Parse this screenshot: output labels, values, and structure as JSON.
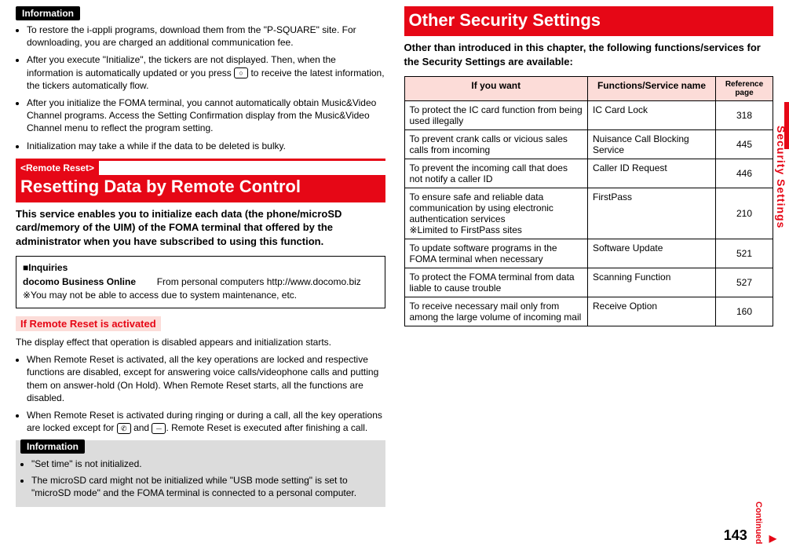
{
  "side_label": "Security Settings",
  "page_number": "143",
  "continued_label": "Continued",
  "left": {
    "info_label": "Information",
    "top_bullets": [
      "To restore the i-αppli programs, download them from the \"P-SQUARE\" site. For downloading, you are charged an additional communication fee.",
      "After you execute \"Initialize\", the tickers are not displayed. Then, when the information is automatically updated or you press ⬜ to receive the latest information, the tickers automatically flow.",
      "After you initialize the FOMA terminal, you cannot automatically obtain Music&Video Channel programs. Access the Setting Confirmation display from the Music&Video Channel menu to reflect the program setting.",
      "Initialization may take a while if the data to be deleted is bulky."
    ],
    "banner_tag": "<Remote Reset>",
    "banner_title": "Resetting Data by Remote Control",
    "lead": "This service enables you to initialize each data (the phone/microSD card/memory of the UIM) of the FOMA terminal that offered by the administrator when you have subscribed to using this function.",
    "box_inq": "■Inquiries",
    "box_line1a": "docomo Business Online",
    "box_line1b": "From personal computers   http://www.docomo.biz",
    "box_line2": "※You may not be able to access due to system maintenance, etc.",
    "sub_pink": "If Remote Reset is activated",
    "para1": "The display effect that operation is disabled appears and initialization starts.",
    "para_bullets": [
      "When Remote Reset is activated, all the key operations are locked and respective functions are disabled, except for answering voice calls/videophone calls and putting them on answer-hold (On Hold). When Remote Reset starts, all the functions are disabled.",
      "When Remote Reset is activated during ringing or during a call, all the key operations are locked except for ⬜ and ⬜. Remote Reset is executed after finishing a call."
    ],
    "info2_label": "Information",
    "info2_bullets": [
      "\"Set time\" is not initialized.",
      "The microSD card might not be initialized while \"USB mode setting\" is set to \"microSD mode\" and the FOMA terminal is connected to a personal computer."
    ]
  },
  "right": {
    "banner_title": "Other Security Settings",
    "lead": "Other than introduced in this chapter, the following functions/services for the Security Settings are available:",
    "headers": {
      "c1": "If you want",
      "c2": "Functions/Service name",
      "c3": "Reference page"
    },
    "rows": [
      {
        "want": "To protect the IC card function from being used illegally",
        "fn": "IC Card Lock",
        "ref": "318"
      },
      {
        "want": "To prevent crank calls or vicious sales calls from incoming",
        "fn": "Nuisance Call Blocking Service",
        "ref": "445"
      },
      {
        "want": "To prevent the incoming call that does not notify a caller ID",
        "fn": "Caller ID Request",
        "ref": "446"
      },
      {
        "want": "To ensure safe and reliable data communication by using electronic authentication services\n※Limited to FirstPass sites",
        "fn": "FirstPass",
        "ref": "210"
      },
      {
        "want": "To update software programs in the FOMA terminal when necessary",
        "fn": "Software Update",
        "ref": "521"
      },
      {
        "want": "To protect the FOMA terminal from data liable to cause trouble",
        "fn": "Scanning Function",
        "ref": "527"
      },
      {
        "want": "To receive necessary mail only from among the large volume of incoming mail",
        "fn": "Receive Option",
        "ref": "160"
      }
    ]
  }
}
